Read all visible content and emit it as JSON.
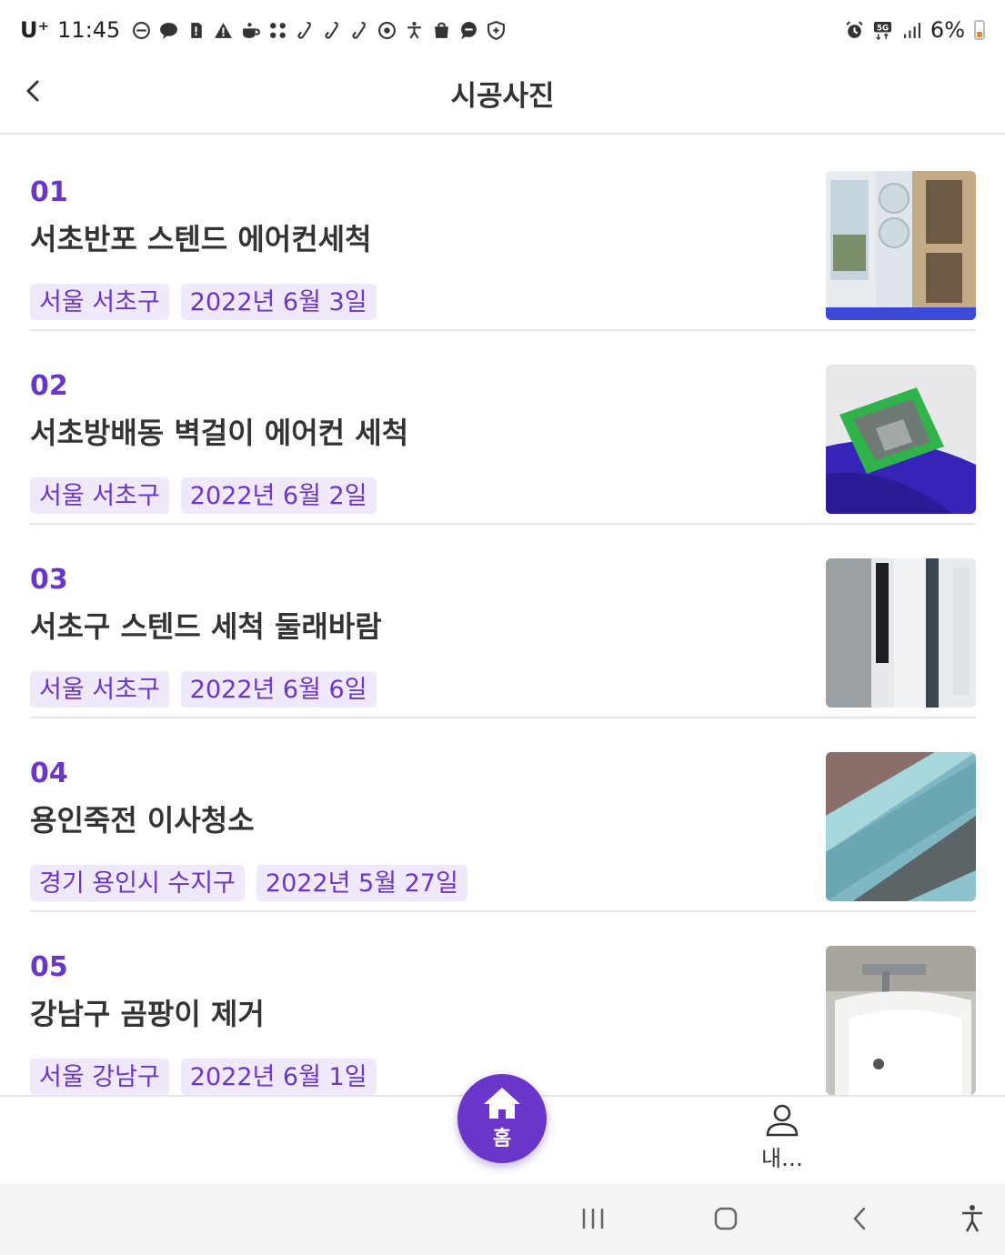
{
  "status_bar": {
    "carrier": "U⁺",
    "time": "11:45",
    "network": "5G",
    "battery": "6%",
    "left_icons": [
      "dnd-icon",
      "kakaotalk-icon",
      "sim-icon",
      "warning-icon",
      "cup-icon",
      "dots-icon",
      "link-icon",
      "link-icon",
      "link-icon",
      "target-icon",
      "accessibility-icon",
      "bag-icon",
      "chat-icon",
      "shield-icon"
    ],
    "right_icons": [
      "alarm-icon",
      "5g-icon",
      "signal-icon",
      "battery-icon"
    ]
  },
  "app_bar": {
    "title": "시공사진",
    "back_icon": "chevron-left-icon"
  },
  "items": [
    {
      "number": "01",
      "title": "서초반포 스텐드 에어컨세척",
      "location": "서울 서초구",
      "date": "2022년 6월 3일",
      "thumbnail": "stand-aircon-photo"
    },
    {
      "number": "02",
      "title": "서초방배동 벽걸이 에어컨 세척",
      "location": "서울 서초구",
      "date": "2022년 6월 2일",
      "thumbnail": "wall-aircon-cleaning-photo"
    },
    {
      "number": "03",
      "title": "서초구 스텐드 세척 둘래바람",
      "location": "서울 서초구",
      "date": "2022년 6월 6일",
      "thumbnail": "stand-aircon-vent-photo"
    },
    {
      "number": "04",
      "title": "용인죽전 이사청소",
      "location": "경기 용인시 수지구",
      "date": "2022년 5월 27일",
      "thumbnail": "window-frame-photo"
    },
    {
      "number": "05",
      "title": "강남구 곰팡이 제거",
      "location": "서울 강남구",
      "date": "2022년 6월 1일",
      "thumbnail": "bathtub-photo"
    }
  ],
  "bottom_nav": {
    "home_label": "홈",
    "my_label": "내…"
  },
  "colors": {
    "accent": "#6a35c9",
    "tag_bg": "#efe9fb",
    "text": "#333333"
  }
}
